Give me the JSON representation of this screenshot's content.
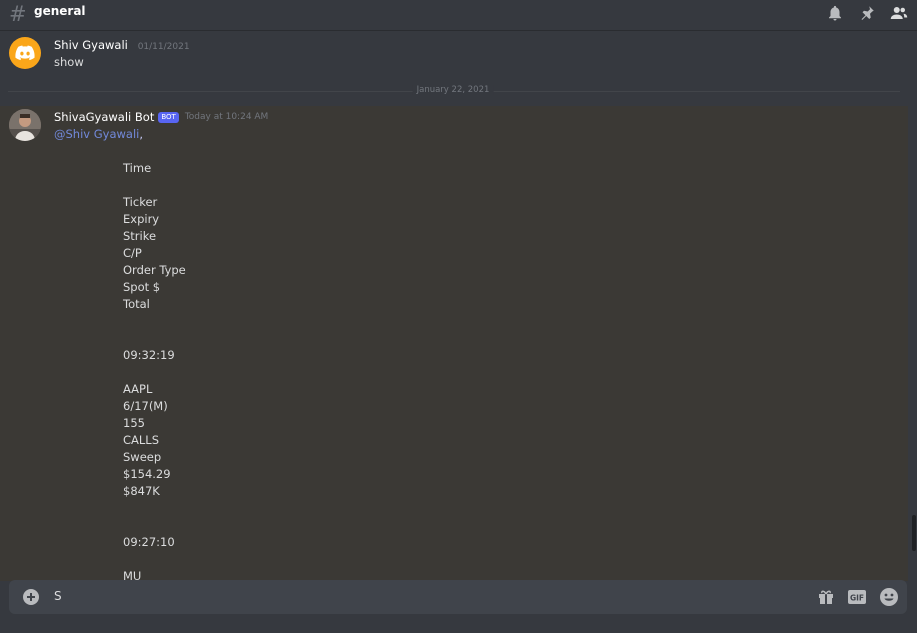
{
  "channel": {
    "hash": "#",
    "name": "general"
  },
  "messages": [
    {
      "author": "Shiv Gyawali",
      "timestamp": "01/11/2021",
      "text": "show"
    },
    {
      "author": "ShivaGyawali Bot",
      "badge": "BOT",
      "timestamp": "Today at 10:24 AM",
      "mention": "@Shiv Gyawali",
      "mention_suffix": ",",
      "lines": [
        "Time",
        "Ticker",
        "Expiry",
        "Strike",
        "C/P",
        "Order Type",
        "Spot $",
        "Total",
        "09:32:19",
        "AAPL",
        "6/17(M)",
        "155",
        "CALLS",
        "Sweep",
        "$154.29",
        "$847K",
        "09:27:10",
        "MU"
      ]
    }
  ],
  "date_divider": "January 22, 2021",
  "composer": {
    "value": "S"
  },
  "icons": {
    "top": [
      "bell-icon",
      "pin-icon",
      "members-icon"
    ],
    "composer": [
      "plus-circle-icon",
      "gift-icon",
      "gif-icon",
      "emoji-icon"
    ]
  },
  "colors": {
    "accent": "#5865f2",
    "mention": "#7289da",
    "avatar_default": "#faa61a"
  }
}
